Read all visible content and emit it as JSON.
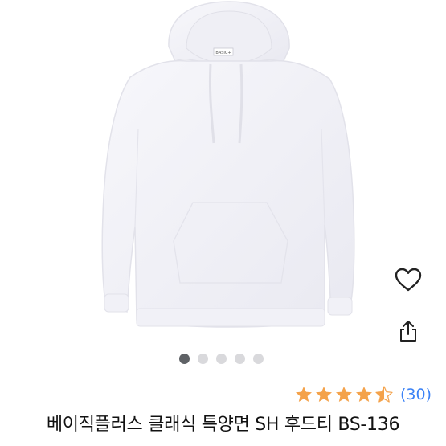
{
  "product": {
    "title": "베이직플러스 클래식 특양면 SH 후드티 BS-136",
    "image_alt": "white hoodie",
    "label_text": "BASIC+"
  },
  "gallery": {
    "total_slides": 5,
    "active_index": 0
  },
  "rating": {
    "value": 4.5,
    "max": 5,
    "count_text": "(30)"
  },
  "icons": {
    "wishlist": "heart-outline-icon",
    "share": "share-icon"
  },
  "colors": {
    "star": "#f4a24a",
    "link": "#3b82f6",
    "dot_active": "#5f6266",
    "dot_inactive": "#d9d9dc"
  }
}
